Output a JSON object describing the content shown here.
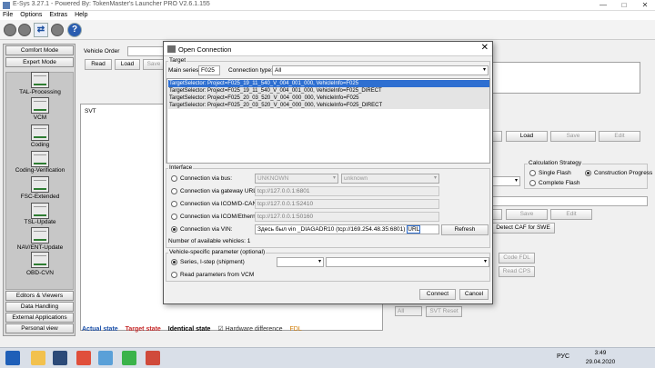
{
  "window": {
    "title": "E-Sys 3.27.1 - Powered By: TokenMaster's Launcher PRO V2.6.1.155",
    "controls": {
      "minimize": "—",
      "maximize": "□",
      "close": "✕"
    }
  },
  "menu": [
    "File",
    "Options",
    "Extras",
    "Help"
  ],
  "toolbar": {
    "help_glyph": "?"
  },
  "sidebar": {
    "top_buttons": [
      "Comfort Mode",
      "Expert Mode"
    ],
    "tools": [
      "TAL-Processing",
      "VCM",
      "Coding",
      "Coding-Verification",
      "FSC-Extended",
      "TSL-Update",
      "NAV/ENT-Update",
      "OBD-CVN"
    ],
    "bottom_buttons": [
      "Editors & Viewers",
      "Data Handling",
      "External Applications",
      "Personal view"
    ]
  },
  "main": {
    "vehicle_order_label": "Vehicle Order",
    "read_button": "Read",
    "load_button": "Load",
    "save_button": "Save",
    "svt_label": "SVT",
    "right_buttons": [
      "Load",
      "Save",
      "Edit"
    ],
    "calc_strategy": {
      "title": "Calculation Strategy",
      "options": [
        "Single Flash",
        "Construction Progress",
        "Complete Flash"
      ],
      "selected": "Construction Progress"
    },
    "save_btn2": "Save",
    "edit_btn2": "Edit",
    "detect_caf": "Detect CAF for SWE",
    "code_fdl": "Code FDL",
    "read_cps": "Read CPS",
    "all_combo": "All",
    "svt_reset": "SVT Reset"
  },
  "legend": [
    {
      "text": "Actual state",
      "color": "#1a4fa8"
    },
    {
      "text": "Target state",
      "color": "#c62828"
    },
    {
      "text": "Identical state",
      "color": "#000000"
    },
    {
      "text": "☑ Hardware difference",
      "color": "#333333"
    },
    {
      "text": "FDL",
      "color": "#d07a00"
    }
  ],
  "dialog": {
    "title": "Open Connection",
    "target_group": "Target",
    "main_series_label": "Main series:",
    "main_series_value": "F025",
    "connection_type_label": "Connection type:",
    "connection_type_value": "All",
    "targets": [
      "TargetSelector: Project=F025_19_11_540_V_004_001_000, VehicleInfo=F025",
      "TargetSelector: Project=F025_19_11_540_V_004_001_000, VehicleInfo=F025_DIRECT",
      "TargetSelector: Project=F025_20_03_520_V_004_000_000, VehicleInfo=F025",
      "TargetSelector: Project=F025_20_03_520_V_004_000_000, VehicleInfo=F025_DIRECT"
    ],
    "interface_group": "Interface",
    "interfaces": [
      {
        "label": "Connection via bus:",
        "value": "UNKNOWN",
        "value2": "unknown"
      },
      {
        "label": "Connection via gateway URL:",
        "value": "tcp://127.0.0.1:6801"
      },
      {
        "label": "Connection via ICOM/D-CAN:",
        "value": "tcp://127.0.0.1:52410"
      },
      {
        "label": "Connection via ICOM/Ethernet:",
        "value": "tcp://127.0.0.1:50160"
      },
      {
        "label": "Connection via VIN:",
        "value_prefix": "Здесь был vin",
        "value": "_DIAGADR10 (tcp://169.254.48.35:6801)",
        "value_suffix": "URL"
      }
    ],
    "selected_interface": "Connection via VIN:",
    "refresh_button": "Refresh",
    "available_vehicles": "Number of available vehicles: 1",
    "vehicle_param_group": "Vehicle-specific parameter (optional)",
    "param_options": [
      "Series, I-step (shipment)",
      "Read parameters from VCM"
    ],
    "selected_param": "Series, I-step (shipment)",
    "connect_button": "Connect",
    "cancel_button": "Cancel"
  },
  "taskbar": {
    "lang": "РУС",
    "time": "3:49",
    "date": "29.04.2020"
  }
}
